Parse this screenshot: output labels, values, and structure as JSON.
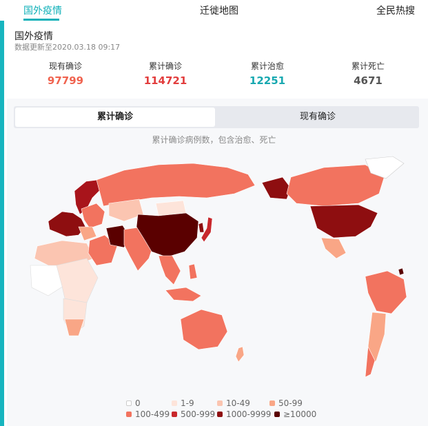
{
  "nav": {
    "tabs": [
      {
        "label": "国外疫情",
        "active": true
      },
      {
        "label": "迁徙地图",
        "active": false
      },
      {
        "label": "全民热搜",
        "active": false
      }
    ]
  },
  "header": {
    "title": "国外疫情",
    "updated": "数据更新至2020.03.18 09:17"
  },
  "stats": [
    {
      "label": "现有确诊",
      "value": "97799",
      "color": "#f0634f"
    },
    {
      "label": "累计确诊",
      "value": "114721",
      "color": "#e23d3d"
    },
    {
      "label": "累计治愈",
      "value": "12251",
      "color": "#17a8b0"
    },
    {
      "label": "累计死亡",
      "value": "4671",
      "color": "#555555"
    }
  ],
  "map_panel": {
    "toggle": {
      "selected": "累计确诊",
      "other": "现有确诊"
    },
    "caption": "累计确诊病例数，包含治愈、死亡"
  },
  "legend": [
    {
      "label": "0",
      "color": "#ffffff"
    },
    {
      "label": "1-9",
      "color": "#fde4da"
    },
    {
      "label": "10-49",
      "color": "#fbc5b1"
    },
    {
      "label": "50-99",
      "color": "#f9a686"
    },
    {
      "label": "100-499",
      "color": "#f2735f"
    },
    {
      "label": "500-999",
      "color": "#c8272c"
    },
    {
      "label": "1000-9999",
      "color": "#8e0e10"
    },
    {
      "label": "≥10000",
      "color": "#5a0000"
    }
  ]
}
